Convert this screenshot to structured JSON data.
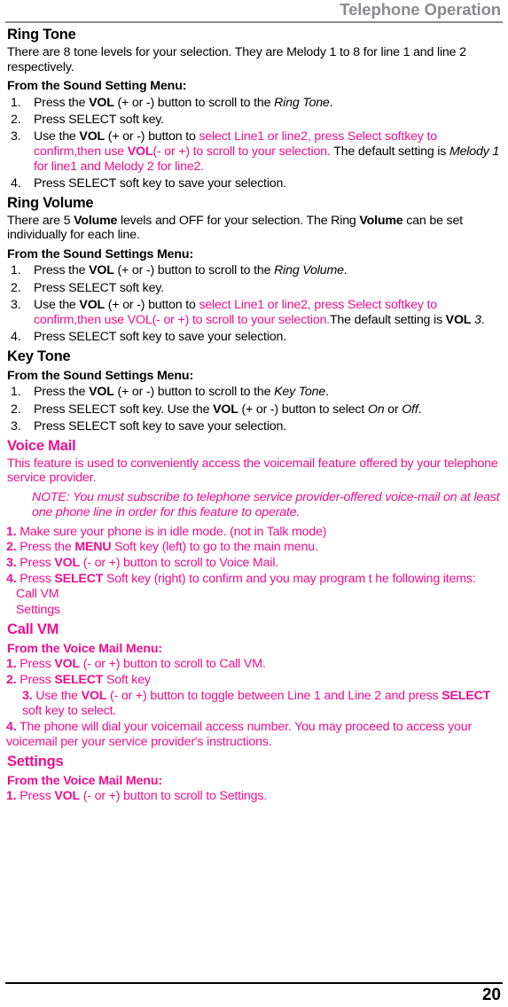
{
  "header": {
    "running_title": "Telephone Operation"
  },
  "footer": {
    "page_number": "20"
  },
  "colors": {
    "accent_magenta": "#ed0f8c",
    "header_gray": "#8a8a8f",
    "body_black": "#000000"
  },
  "sections": {
    "ring_tone": {
      "heading": "Ring Tone",
      "intro": "There are 8 tone levels for your selection. They are Melody 1 to 8 for line 1 and line 2 respectively.",
      "sub_heading": "From the Sound Setting Menu:",
      "steps": [
        {
          "num": "1.",
          "text_a": "Press the ",
          "bold_a": "VOL",
          "text_b": " (+ or -) button to scroll to the ",
          "italic_a": "Ring Tone",
          "text_c": "."
        },
        {
          "num": "2.",
          "text_a": "Press SELECT soft key."
        },
        {
          "num": "3.",
          "text_a": "Use the ",
          "bold_a": "VOL",
          "text_b": " (+ or -) button to ",
          "magenta_a": "select Line1 or line2, press Select softkey to confirm,then use ",
          "magenta_bold": "VOL",
          "magenta_b": "(- or +) to scroll to your selection.",
          "text_c": " The default setting is ",
          "italic_a": "Melody 1",
          "magenta_c": "  for line1 and Melody 2 for line2."
        },
        {
          "num": "4.",
          "text_a": "Press SELECT soft key to save your selection."
        }
      ]
    },
    "ring_volume": {
      "heading": "Ring Volume",
      "intro_a": "There are 5 ",
      "intro_bold_a": "Volume",
      "intro_b": " levels and OFF for your selection. The Ring ",
      "intro_bold_b": "Volume",
      "intro_c": " can be set individually for each line.",
      "sub_heading": "From the Sound Settings Menu:",
      "steps": [
        {
          "num": "1.",
          "text_a": "Press the ",
          "bold_a": "VOL",
          "text_b": " (+ or -) button to scroll to the ",
          "italic_a": "Ring Volume",
          "text_c": "."
        },
        {
          "num": "2.",
          "text_a": "Press SELECT soft key."
        },
        {
          "num": "3.",
          "text_a": "Use the ",
          "bold_a": "VOL",
          "text_b": " (+ or -) button to ",
          "magenta_a": "select Line1 or line2, press Select softkey to confirm,then use VOL(- or +) to scroll to your selection.",
          "text_c": "The default setting is  ",
          "bold_b": "VOL",
          "italic_a": " 3",
          "text_d": "."
        },
        {
          "num": "4.",
          "text_a": "Press SELECT soft key to save your selection."
        }
      ]
    },
    "key_tone": {
      "heading": "Key Tone",
      "sub_heading": "From the Sound Settings Menu:",
      "steps": [
        {
          "num": "1.",
          "text_a": "Press the ",
          "bold_a": "VOL",
          "text_b": " (+ or -) button to scroll to the ",
          "italic_a": "Key Tone",
          "text_c": "."
        },
        {
          "num": "2.",
          "text_a": "Press SELECT soft key. Use the ",
          "bold_a": "VOL",
          "text_b": " (+ or -) button to select ",
          "italic_a": "On",
          "text_c": " or ",
          "italic_b": "Off",
          "text_d": "."
        },
        {
          "num": "3.",
          "text_a": "Press SELECT soft key to save your selection."
        }
      ]
    },
    "voice_mail": {
      "heading": "Voice Mail",
      "intro": "This feature is used to conveniently access the voicemail feature offered by your telephone service provider.",
      "note": "NOTE: You must subscribe to telephone service provider-offered voice-mail on at least one phone line in order for this feature to operate.",
      "steps": [
        {
          "num": "1.",
          "text_a": " Make sure your phone is in idle mode. (not in Talk mode)"
        },
        {
          "num": "2.",
          "text_a": " Press the ",
          "bold_a": "MENU",
          "text_b": " Soft key (left) to go to the main menu."
        },
        {
          "num": "3.",
          "text_a": " Press ",
          "bold_a": "VOL",
          "text_b": " (- or +) button to scroll to Voice Mail."
        },
        {
          "num": "4.",
          "text_a": " Press ",
          "bold_a": "SELECT",
          "text_b": " Soft key (right) to confirm and you may program t he following items:"
        }
      ],
      "items": [
        "Call VM",
        "Settings"
      ]
    },
    "call_vm": {
      "heading": "Call VM",
      "sub_heading": "From the Voice Mail Menu:",
      "steps": [
        {
          "num": "1.",
          "text_a": " Press ",
          "bold_a": "VOL",
          "text_b": " (- or +) button to scroll to Call VM."
        },
        {
          "num": "2.",
          "text_a": " Press ",
          "bold_a": "SELECT",
          "text_b": " Soft key"
        },
        {
          "num": "3.",
          "text_a": " Use the ",
          "bold_a": "VOL",
          "text_b": " (- or +) button to toggle between Line 1 and Line 2 and press ",
          "bold_b": "SELECT",
          "text_c": " soft key to select."
        },
        {
          "num": "4.",
          "text_a": " The phone will dial your voicemail access number. You may proceed to access your voicemail per your service provider's instructions."
        }
      ]
    },
    "settings": {
      "heading": "Settings",
      "sub_heading": "From the Voice Mail Menu:",
      "steps": [
        {
          "num": "1.",
          "text_a": " Press ",
          "bold_a": "VOL",
          "text_b": " (- or +) button to scroll to Settings."
        }
      ]
    }
  }
}
